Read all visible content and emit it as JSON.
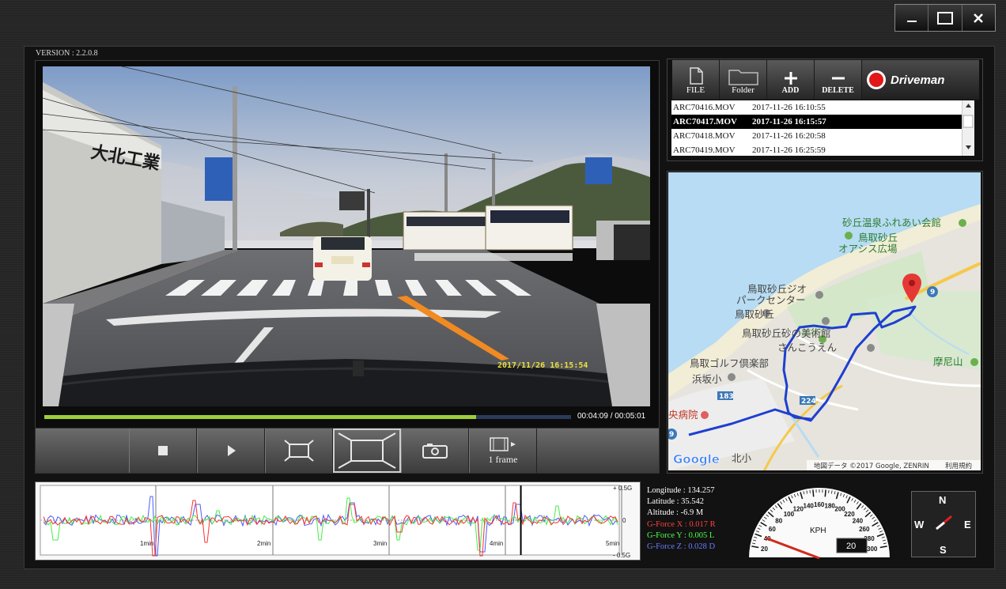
{
  "app": {
    "version": "VERSION : 2.2.0.8",
    "window_buttons": {
      "minimize": "—",
      "maximize": "☐",
      "close": "✕"
    }
  },
  "video": {
    "timestamp_overlay": "2017/11/26 16:15:54",
    "progress_fraction": 0.82,
    "time_current": "00:04:09",
    "time_separator": " / ",
    "time_total": "00:05:01",
    "sign_text": "大北工業"
  },
  "controls": {
    "frame_label": "1 frame"
  },
  "toolbar": {
    "file_label": "FILE",
    "folder_label": "Folder",
    "add_label": "ADD",
    "delete_label": "DELETE",
    "brand": "Driveman"
  },
  "files": [
    {
      "name": "ARC70416.MOV",
      "date": "2017-11-26 16:10:55",
      "selected": false
    },
    {
      "name": "ARC70417.MOV",
      "date": "2017-11-26 16:15:57",
      "selected": true
    },
    {
      "name": "ARC70418.MOV",
      "date": "2017-11-26 16:20:58",
      "selected": false
    },
    {
      "name": "ARC70419.MOV",
      "date": "2017-11-26 16:25:59",
      "selected": false
    }
  ],
  "map": {
    "labels": {
      "onsen": "砂丘温泉ふれあい会館",
      "sakyu": "鳥取砂丘",
      "oasis": "オアシス広場",
      "geo": "鳥取砂丘ジオ",
      "park": "パークセンター",
      "sakyu2": "鳥取砂丘",
      "museum": "鳥取砂丘砂の美術館",
      "sankou": "さんこうえん",
      "golf": "鳥取ゴルフ倶楽部",
      "hamasaka": "浜坂小",
      "hospital": "央病院",
      "kita": "北小",
      "manizan": "摩尼山",
      "copyright": "地図データ ©2017 Google, ZENRIN",
      "terms": "利用規約",
      "google": "Google"
    },
    "route_badges": {
      "r9a": "9",
      "r183": "183",
      "r224": "224",
      "r9b": "9"
    }
  },
  "graph": {
    "top_label": "+ 0.5G",
    "mid_label": "0",
    "bottom_label": "- 0.5G",
    "ticks": [
      "1min",
      "2min",
      "3min",
      "4min",
      "5min"
    ],
    "cursor_fraction": 0.83
  },
  "telemetry": {
    "longitude": "Longitude : 134.257",
    "latitude": "Latitude : 35.542",
    "altitude": "Altitude : -6.9 M",
    "gx": "G-Force X : 0.017 R",
    "gy": "G-Force Y : 0.005 L",
    "gz": "G-Force Z : 0.028 D"
  },
  "speed": {
    "unit": "KPH",
    "value": "20",
    "ticks": [
      "20",
      "40",
      "60",
      "80",
      "100",
      "120",
      "140",
      "160",
      "180",
      "200",
      "220",
      "240",
      "260",
      "280",
      "300"
    ]
  },
  "compass": {
    "n": "N",
    "e": "E",
    "s": "S",
    "w": "W"
  },
  "colors": {
    "progress": "#9fce3a",
    "gx": "#ff3030",
    "gy": "#44ee44",
    "gz": "#4a5cff",
    "route": "#1f3fd0",
    "pin": "#e53935"
  }
}
